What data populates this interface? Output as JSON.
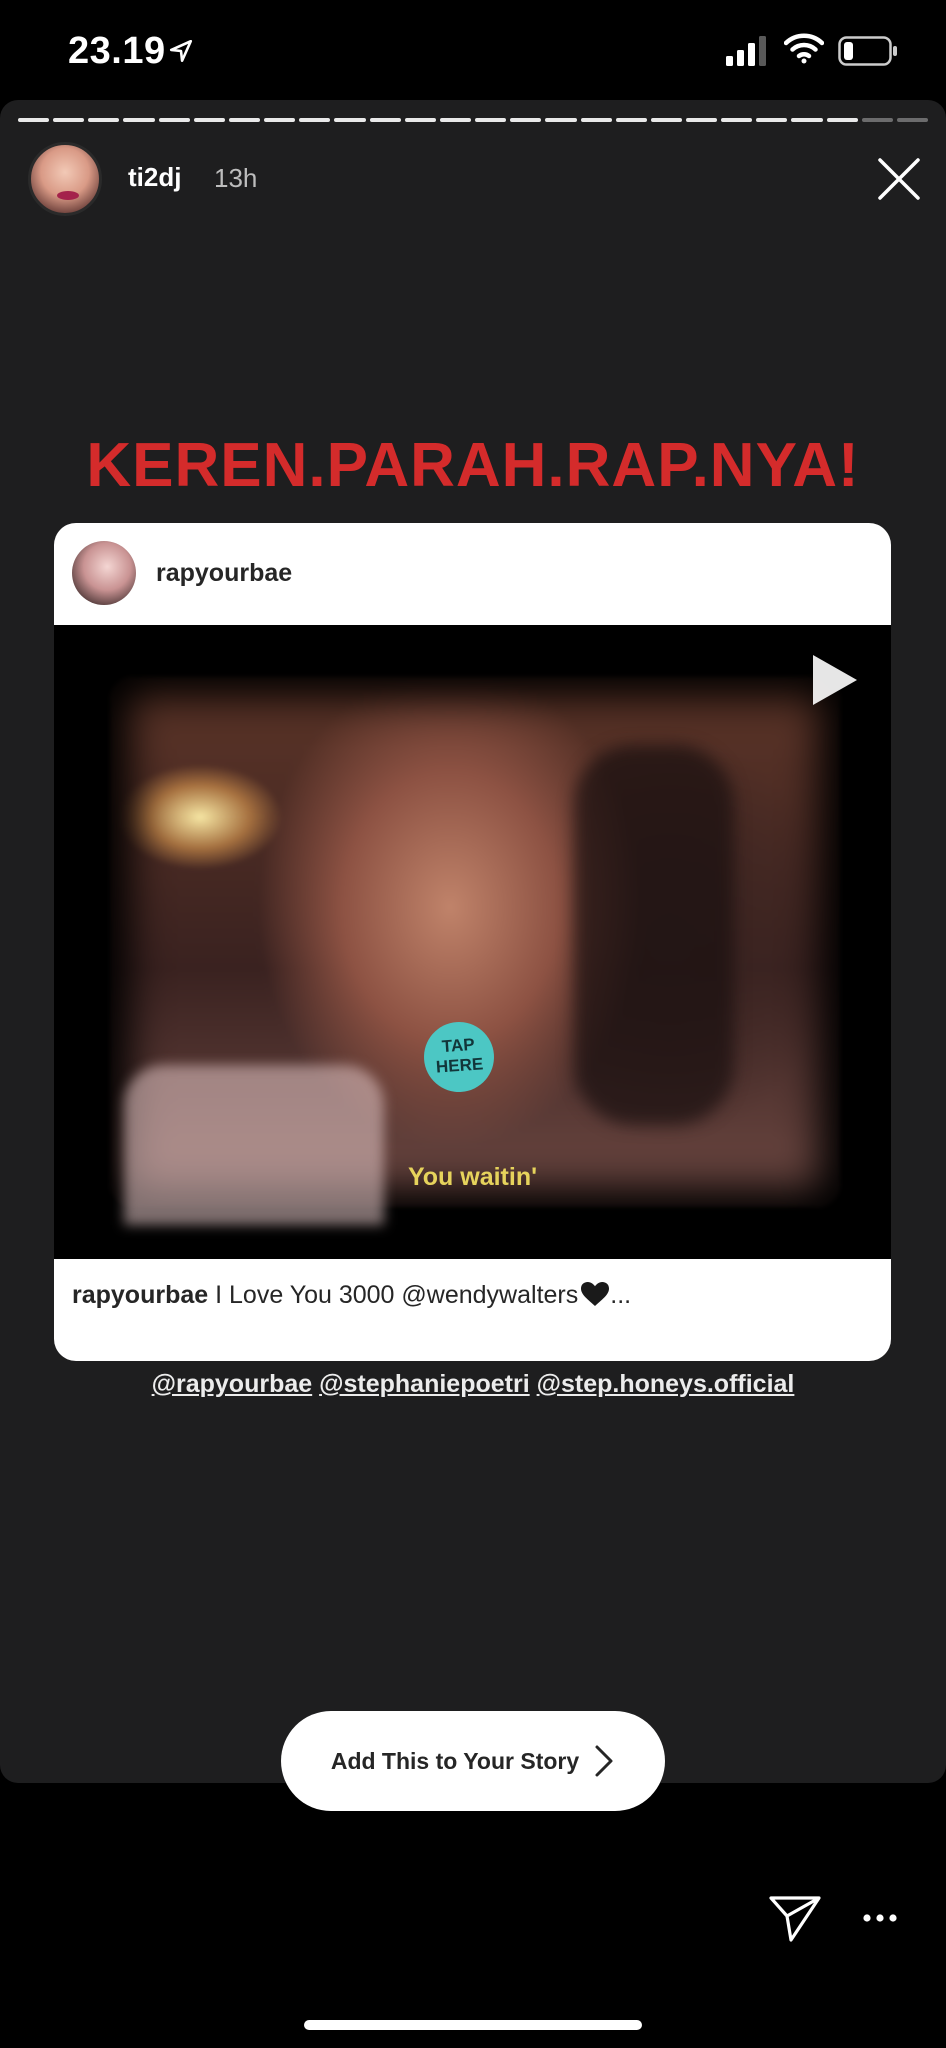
{
  "status_bar": {
    "time": "23.19",
    "icons": [
      "location-arrow-icon",
      "cellular-signal-icon",
      "wifi-icon",
      "battery-icon"
    ]
  },
  "story": {
    "segments_total": 26,
    "segments_viewed": 24,
    "author": "ti2dj",
    "age": "13h",
    "headline": "KEREN.PARAH.RAP.NYA!",
    "headline_color": "#d42b2b"
  },
  "post_card": {
    "username": "rapyourbae",
    "video_subtitle": "You waitin'",
    "sticker_line1": "TAP",
    "sticker_line2": "HERE",
    "caption_user": "rapyourbae",
    "caption_text": " I Love You 3000 @wendywalters",
    "caption_more": "..."
  },
  "mentions": [
    "@rapyourbae",
    "@stephaniepoetri",
    "@step.honeys.official"
  ],
  "actions": {
    "add_to_story": "Add This to Your Story"
  }
}
